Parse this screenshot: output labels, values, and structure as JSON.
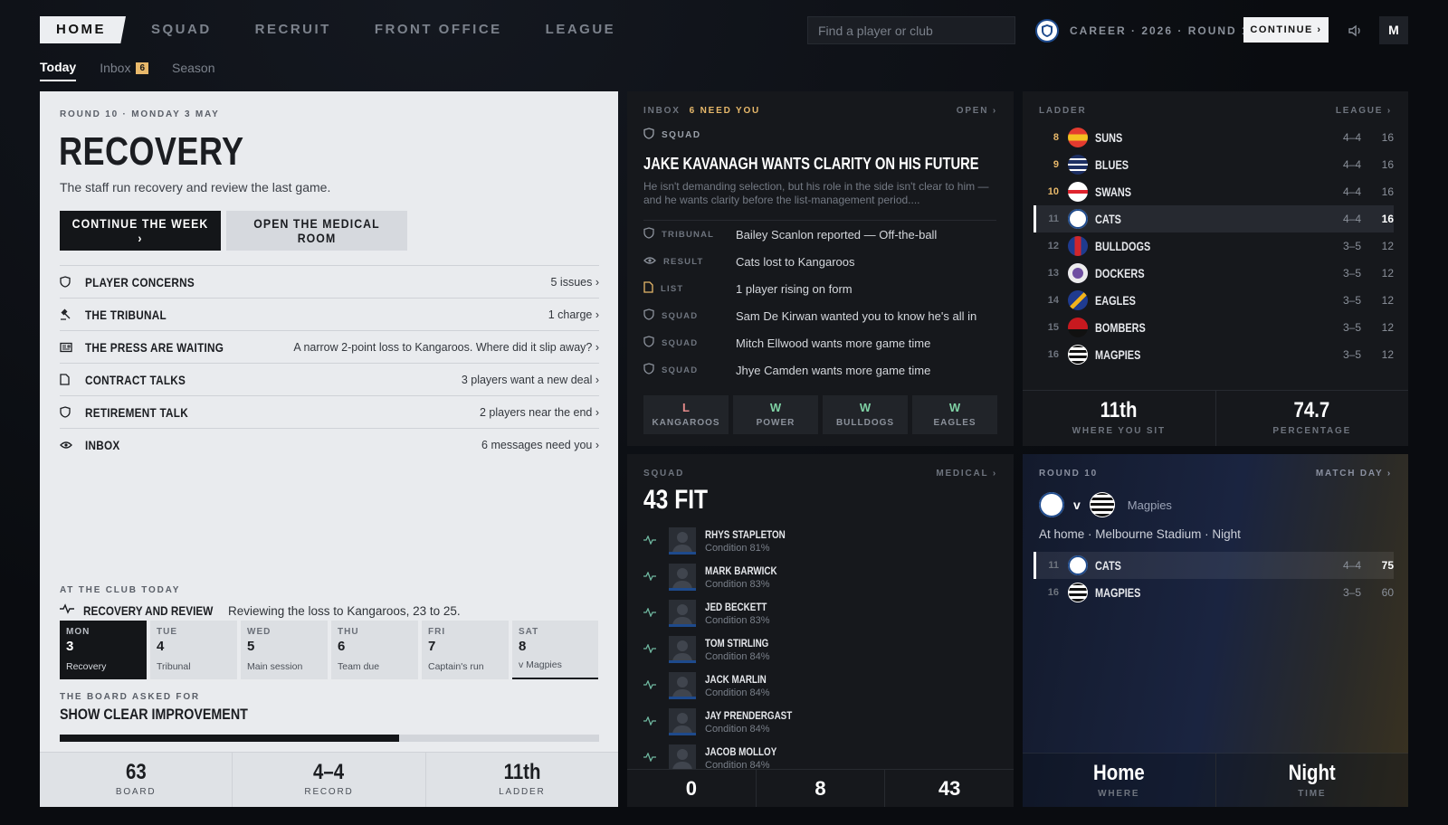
{
  "nav": {
    "items": [
      "HOME",
      "SQUAD",
      "RECRUIT",
      "FRONT OFFICE",
      "LEAGUE"
    ],
    "search_placeholder": "Find a player or club",
    "career": "CAREER · 2026 · ROUND 10",
    "continue": "CONTINUE ›",
    "profile": "M"
  },
  "subtabs": {
    "today": "Today",
    "inbox": "Inbox",
    "inbox_count": "6",
    "season": "Season"
  },
  "today": {
    "kicker": "ROUND 10 · MONDAY 3 MAY",
    "title": "RECOVERY",
    "subtitle": "The staff run recovery and review the last game.",
    "primary_button": "CONTINUE THE WEEK ›",
    "secondary_button": "OPEN THE MEDICAL ROOM",
    "issues": [
      {
        "icon": "shield-icon",
        "label": "PLAYER CONCERNS",
        "value": "5 issues ›"
      },
      {
        "icon": "gavel-icon",
        "label": "THE TRIBUNAL",
        "value": "1 charge ›"
      },
      {
        "icon": "newspaper-icon",
        "label": "THE PRESS ARE WAITING",
        "value": "A narrow 2-point loss to Kangaroos. Where did it slip away? ›"
      },
      {
        "icon": "document-icon",
        "label": "CONTRACT TALKS",
        "value": "3 players want a new deal ›"
      },
      {
        "icon": "shield-icon",
        "label": "RETIREMENT TALK",
        "value": "2 players near the end ›"
      },
      {
        "icon": "eye-icon",
        "label": "INBOX",
        "value": "6 messages need you ›"
      }
    ],
    "club_today_kicker": "AT THE CLUB TODAY",
    "focus_title": "RECOVERY AND REVIEW",
    "focus_desc": "Reviewing the loss to Kangaroos, 23 to 25.",
    "days": [
      {
        "name": "MON",
        "date": "3",
        "event": "Recovery"
      },
      {
        "name": "TUE",
        "date": "4",
        "event": "Tribunal"
      },
      {
        "name": "WED",
        "date": "5",
        "event": "Main session"
      },
      {
        "name": "THU",
        "date": "6",
        "event": "Team due"
      },
      {
        "name": "FRI",
        "date": "7",
        "event": "Captain's run"
      },
      {
        "name": "SAT",
        "date": "8",
        "event": "v Magpies"
      }
    ],
    "board_kicker": "THE BOARD ASKED FOR",
    "board_title": "SHOW CLEAR IMPROVEMENT",
    "board_progress": 0.63,
    "stats": [
      {
        "value": "63",
        "label": "BOARD"
      },
      {
        "value": "4–4",
        "label": "RECORD"
      },
      {
        "value": "11th",
        "label": "LADDER"
      }
    ]
  },
  "inbox": {
    "kicker": "INBOX",
    "need": "6 NEED YOU",
    "link": "OPEN ›",
    "tag": "SQUAD",
    "headline": "JAKE KAVANAGH WANTS CLARITY ON HIS FUTURE",
    "body": "He isn't demanding selection, but his role in the side isn't clear to him — and he wants clarity before the list-management period....",
    "messages": [
      {
        "icon": "shield-icon",
        "tag": "TRIBUNAL",
        "text": "Bailey Scanlon reported — Off-the-ball"
      },
      {
        "icon": "eye-icon",
        "tag": "RESULT",
        "text": "Cats lost to Kangaroos"
      },
      {
        "icon": "document-icon",
        "tag": "LIST",
        "text": "1 player rising on form"
      },
      {
        "icon": "shield-icon",
        "tag": "SQUAD",
        "text": "Sam De Kirwan wanted you to know he's all in"
      },
      {
        "icon": "shield-icon",
        "tag": "SQUAD",
        "text": "Mitch Ellwood wants more game time"
      },
      {
        "icon": "shield-icon",
        "tag": "SQUAD",
        "text": "Jhye Camden wants more game time"
      }
    ],
    "results": [
      {
        "r": "L",
        "opp": "KANGAROOS",
        "color": "#e58a8a"
      },
      {
        "r": "W",
        "opp": "POWER",
        "color": "#7fd1a4"
      },
      {
        "r": "W",
        "opp": "BULLDOGS",
        "color": "#7fd1a4"
      },
      {
        "r": "W",
        "opp": "EAGLES",
        "color": "#7fd1a4"
      }
    ]
  },
  "ladder": {
    "kicker": "LADDER",
    "link": "LEAGUE ›",
    "rows": [
      {
        "pos": "8",
        "name": "SUNS",
        "wl": "4–4",
        "pts": "16",
        "crest": "suns"
      },
      {
        "pos": "9",
        "name": "BLUES",
        "wl": "4–4",
        "pts": "16",
        "crest": "blues"
      },
      {
        "pos": "10",
        "name": "SWANS",
        "wl": "4–4",
        "pts": "16",
        "crest": "swans"
      },
      {
        "pos": "11",
        "name": "CATS",
        "wl": "4–4",
        "pts": "16",
        "crest": "cats",
        "mine": true
      },
      {
        "pos": "12",
        "name": "BULLDOGS",
        "wl": "3–5",
        "pts": "12",
        "crest": "bulldogs"
      },
      {
        "pos": "13",
        "name": "DOCKERS",
        "wl": "3–5",
        "pts": "12",
        "crest": "dockers"
      },
      {
        "pos": "14",
        "name": "EAGLES",
        "wl": "3–5",
        "pts": "12",
        "crest": "eagles"
      },
      {
        "pos": "15",
        "name": "BOMBERS",
        "wl": "3–5",
        "pts": "12",
        "crest": "bombers"
      },
      {
        "pos": "16",
        "name": "MAGPIES",
        "wl": "3–5",
        "pts": "12",
        "crest": "magpies"
      }
    ],
    "stats": [
      {
        "value": "11th",
        "label": "WHERE YOU SIT"
      },
      {
        "value": "74.7",
        "label": "PERCENTAGE"
      }
    ]
  },
  "squad": {
    "kicker": "SQUAD",
    "link": "MEDICAL ›",
    "fit": "43 FIT",
    "players": [
      {
        "name": "RHYS STAPLETON",
        "cond": "Condition 81%"
      },
      {
        "name": "MARK BARWICK",
        "cond": "Condition 83%"
      },
      {
        "name": "JED BECKETT",
        "cond": "Condition 83%"
      },
      {
        "name": "TOM STIRLING",
        "cond": "Condition 84%"
      },
      {
        "name": "JACK MARLIN",
        "cond": "Condition 84%"
      },
      {
        "name": "JAY PRENDERGAST",
        "cond": "Condition 84%"
      },
      {
        "name": "JACOB MOLLOY",
        "cond": "Condition 84%"
      }
    ],
    "stats": [
      "0",
      "8",
      "43"
    ]
  },
  "match": {
    "kicker": "ROUND 10",
    "link": "MATCH DAY ›",
    "v": "v",
    "opponent": "Magpies",
    "venue": "At home · Melbourne Stadium · Night",
    "rows": [
      {
        "pos": "11",
        "name": "CATS",
        "wl": "4–4",
        "pts": "75",
        "crest": "cats",
        "mine": true
      },
      {
        "pos": "16",
        "name": "MAGPIES",
        "wl": "3–5",
        "pts": "60",
        "crest": "magpies"
      }
    ],
    "stats": [
      {
        "value": "Home",
        "label": "WHERE"
      },
      {
        "value": "Night",
        "label": "TIME"
      }
    ]
  },
  "colors": {
    "accent_gold": "#e7b86a",
    "win": "#7fd1a4",
    "loss": "#e58a8a"
  }
}
